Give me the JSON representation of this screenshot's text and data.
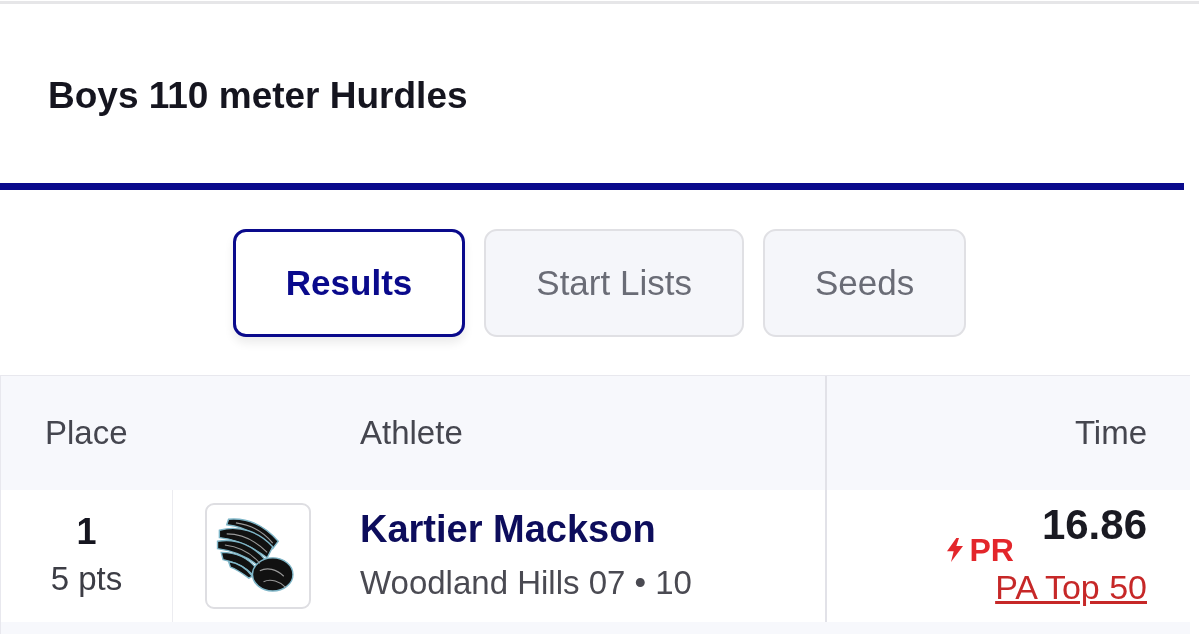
{
  "page": {
    "title": "Boys 110 meter Hurdles"
  },
  "tabs": [
    {
      "label": "Results",
      "selected": true
    },
    {
      "label": "Start Lists",
      "selected": false
    },
    {
      "label": "Seeds",
      "selected": false
    }
  ],
  "table": {
    "columns": [
      "Place",
      "Athlete",
      "Time"
    ],
    "rows": [
      {
        "place": "1",
        "points": "5 pts",
        "athlete": "Kartier Mackson",
        "team": "Woodland Hills 07 • 10",
        "time": "16.86",
        "badge": "PR",
        "ranking_link": "PA Top 50"
      }
    ]
  }
}
